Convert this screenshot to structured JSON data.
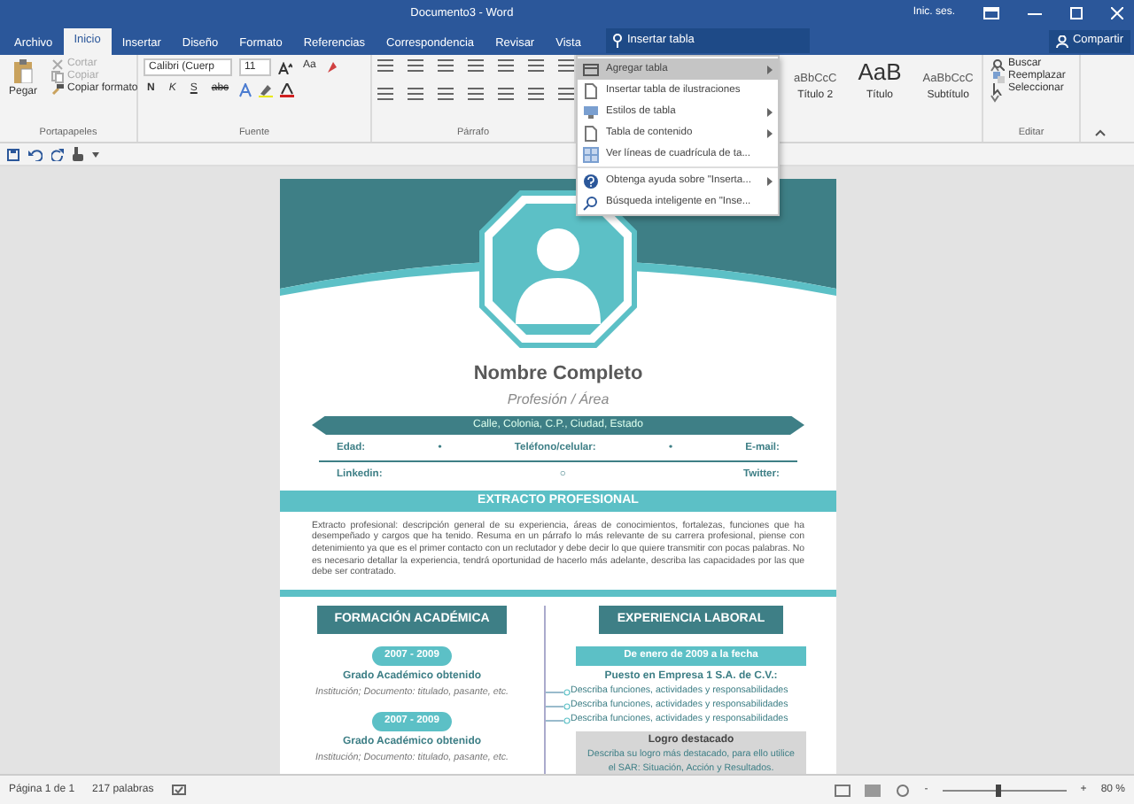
{
  "window": {
    "title": "Documento3 - Word",
    "user": "Inic. ses."
  },
  "tabs": [
    {
      "label": "Archivo",
      "selected": false
    },
    {
      "label": "Inicio",
      "selected": true
    },
    {
      "label": "Insertar",
      "selected": false
    },
    {
      "label": "Diseño",
      "selected": false
    },
    {
      "label": "Formato",
      "selected": false
    },
    {
      "label": "Referencias",
      "selected": false
    },
    {
      "label": "Correspondencia",
      "selected": false
    },
    {
      "label": "Revisar",
      "selected": false
    },
    {
      "label": "Vista",
      "selected": false
    }
  ],
  "tell_me": {
    "value": "Insertar tabla"
  },
  "share_button": "Compartir",
  "ribbon": {
    "clipboard": {
      "paste": "Pegar",
      "items": [
        {
          "label": "Cortar",
          "disabled": true
        },
        {
          "label": "Copiar",
          "disabled": true
        },
        {
          "label": "Copiar formato",
          "disabled": false
        }
      ],
      "label": "Portapapeles"
    },
    "font": {
      "name": "Calibri (Cuerp",
      "size": "11",
      "case": "Aa",
      "buttons": [
        "N",
        "K",
        "S",
        "abc"
      ],
      "label": "Fuente"
    },
    "paragraph": {
      "label": "Párrafo"
    },
    "styles": [
      {
        "sample": "aBbCcC",
        "label": "Título 2",
        "big": false
      },
      {
        "sample": "AaB",
        "label": "Título",
        "big": true
      },
      {
        "sample": "AaBbCcC",
        "label": "Subtítulo",
        "big": false
      }
    ],
    "editing": {
      "label": "Editar",
      "items": [
        "Buscar",
        "Reemplazar",
        "Seleccionar"
      ]
    }
  },
  "menu": [
    {
      "label": "Agregar tabla",
      "kind": "table",
      "submenu": true,
      "selected": true
    },
    {
      "label": "Insertar tabla de ilustraciones",
      "kind": "page",
      "submenu": false,
      "selected": false
    },
    {
      "label": "Estilos de tabla",
      "kind": "styles",
      "submenu": true,
      "selected": false
    },
    {
      "label": "Tabla de contenido",
      "kind": "page",
      "submenu": true,
      "selected": false
    },
    {
      "label": "Ver líneas de cuadrícula de ta...",
      "kind": "grid",
      "submenu": false,
      "selected": false
    },
    {
      "label": "Obtenga ayuda sobre \"Inserta...",
      "kind": "help",
      "submenu": true,
      "selected": false
    },
    {
      "label": "Búsqueda inteligente en \"Inse...",
      "kind": "search",
      "submenu": false,
      "selected": false
    }
  ],
  "document": {
    "name": "Nombre Completo",
    "profession": "Profesión / Área",
    "address": "Calle, Colonia, C.P., Ciudad, Estado",
    "contact_rows": [
      [
        "Edad:",
        "•",
        "Teléfono/celular:",
        "•",
        "E-mail:"
      ],
      [
        "Linkedin:",
        "○",
        "Twitter:"
      ]
    ],
    "summary_title": "EXTRACTO PROFESIONAL",
    "summary": "Extracto profesional: descripción general de su experiencia, áreas de conocimientos, fortalezas, funciones que ha desempeñado y cargos que ha tenido. Resuma en un párrafo lo más relevante de su carrera profesional, piense con detenimiento ya que es el primer contacto con un reclutador y debe decir lo que quiere transmitir con pocas palabras. No es necesario detallar la experiencia, tendrá oportunidad de hacerlo más adelante, describa las capacidades por las que debe ser contratado.",
    "education_title": "FORMACIÓN ACADÉMICA",
    "education": [
      {
        "years": "2007 - 2009",
        "degree": "Grado Académico obtenido",
        "detail": "Institución; Documento: titulado, pasante, etc."
      },
      {
        "years": "2007 - 2009",
        "degree": "Grado Académico obtenido",
        "detail": "Institución; Documento: titulado, pasante, etc."
      }
    ],
    "experience_title": "EXPERIENCIA LABORAL",
    "experience": {
      "period": "De enero de 2009 a la fecha",
      "position": "Puesto en Empresa 1 S.A. de C.V.:",
      "duties": [
        "Describa funciones, actividades y responsabilidades",
        "Describa funciones, actividades y responsabilidades",
        "Describa funciones, actividades y responsabilidades"
      ],
      "highlight_title": "Logro destacado",
      "highlight": "Describa su logro más destacado, para ello utilice el SAR: Situación, Acción y Resultados."
    }
  },
  "status_bar": {
    "page": "Página 1 de 1",
    "words": "217 palabras",
    "zoom_minus": "-",
    "zoom_plus": "+",
    "zoom_slider": {
      "level": 0.45
    },
    "zoom": "80 %"
  }
}
